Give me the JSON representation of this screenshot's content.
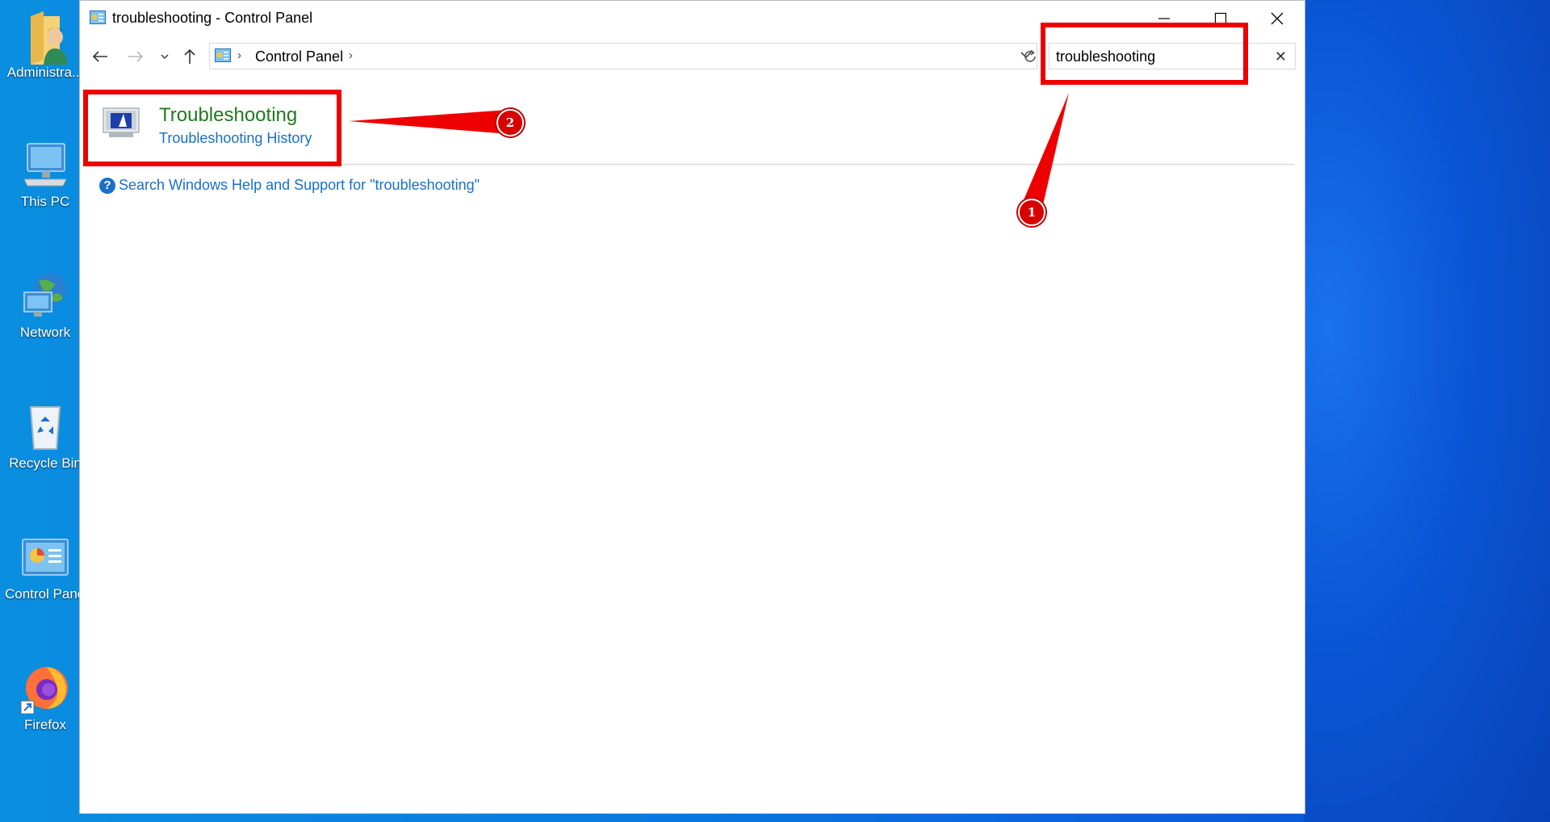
{
  "desktop": {
    "icons": [
      {
        "label": "Administra...",
        "icon": "user-folder-icon"
      },
      {
        "label": "This PC",
        "icon": "computer-icon"
      },
      {
        "label": "Network",
        "icon": "network-globe-icon"
      },
      {
        "label": "Recycle Bin",
        "icon": "recycle-bin-icon"
      },
      {
        "label": "Control Panel",
        "icon": "control-panel-icon"
      },
      {
        "label": "Firefox",
        "icon": "firefox-icon"
      }
    ]
  },
  "window": {
    "title": "troubleshooting - Control Panel",
    "breadcrumb": {
      "label": "Control Panel",
      "separator": "›"
    },
    "search": {
      "value": "troubleshooting",
      "clear_label": "✕"
    },
    "result": {
      "title": "Troubleshooting",
      "link": "Troubleshooting History"
    },
    "help_link": "Search Windows Help and Support for \"troubleshooting\""
  },
  "annotations": {
    "step1": "1",
    "step2": "2",
    "color": "#ee0000"
  }
}
